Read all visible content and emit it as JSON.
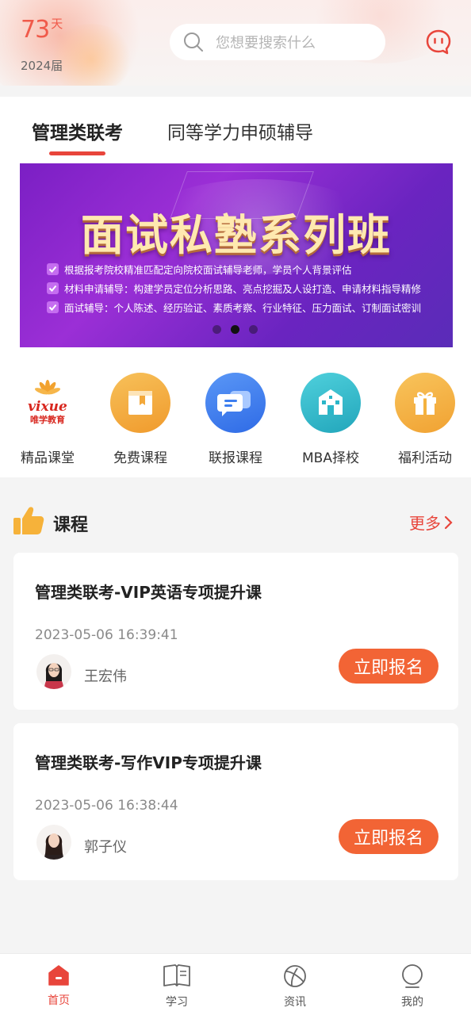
{
  "header": {
    "countdown_value": "73",
    "countdown_unit": "天",
    "grad_year": "2024届",
    "search_placeholder": "您想要搜索什么"
  },
  "tabs": [
    {
      "label": "管理类联考",
      "active": true
    },
    {
      "label": "同等学力申硕辅导",
      "active": false
    }
  ],
  "banner": {
    "title": "面试私塾系列班",
    "lines": [
      "根据报考院校精准匹配定向院校面试辅导老师，学员个人背景评估",
      "材料申请辅导：构建学员定位分析思路、亮点挖掘及人设打造、申请材料指导精修",
      "面试辅导：个人陈述、经历验证、素质考察、行业特征、压力面试、订制面试密训"
    ],
    "active_slide": 2,
    "slide_count": 3
  },
  "quick_links": [
    {
      "label": "精品课堂",
      "icon": "vixue-logo-icon",
      "logo_en": "vixue",
      "logo_cn": "唯学教育"
    },
    {
      "label": "免费课程",
      "icon": "book-icon",
      "color": "#f3a83a"
    },
    {
      "label": "联报课程",
      "icon": "chat-bubbles-icon",
      "color": "#3d7ef0"
    },
    {
      "label": "MBA择校",
      "icon": "school-building-icon",
      "color": "#2bb6c8"
    },
    {
      "label": "福利活动",
      "icon": "gift-icon",
      "color": "#f4b23e"
    }
  ],
  "courses_section": {
    "title": "课程",
    "more_label": "更多"
  },
  "courses": [
    {
      "title": "管理类联考-VIP英语专项提升课",
      "datetime": "2023-05-06 16:39:41",
      "teacher": "王宏伟",
      "button": "立即报名"
    },
    {
      "title": "管理类联考-写作VIP专项提升课",
      "datetime": "2023-05-06 16:38:44",
      "teacher": "郭子仪",
      "button": "立即报名"
    }
  ],
  "bottom_nav": [
    {
      "label": "首页",
      "icon": "home-icon",
      "active": true
    },
    {
      "label": "学习",
      "icon": "open-book-icon",
      "active": false
    },
    {
      "label": "资讯",
      "icon": "news-planet-icon",
      "active": false
    },
    {
      "label": "我的",
      "icon": "profile-icon",
      "active": false
    }
  ],
  "colors": {
    "accent": "#e8453b",
    "signup_button": "#f26435",
    "banner_purple": "#8a2bd0"
  }
}
